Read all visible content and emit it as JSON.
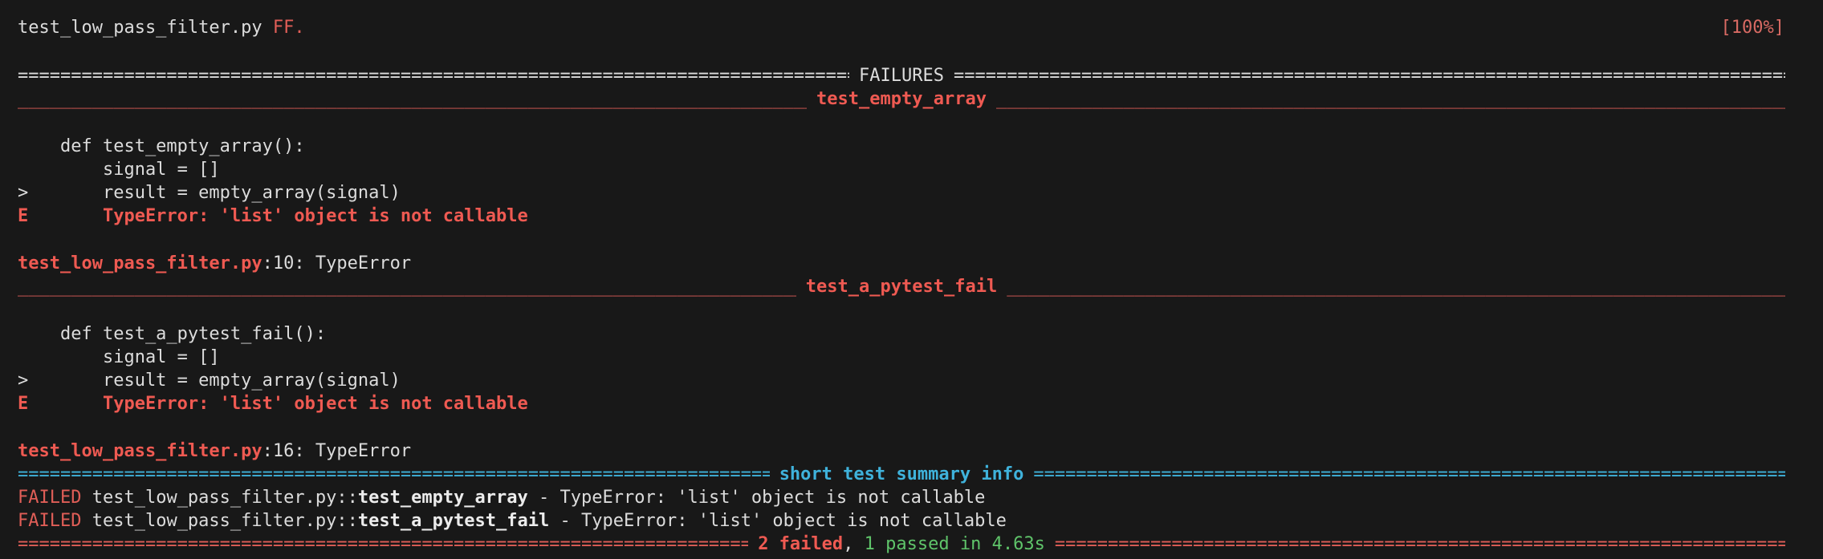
{
  "header": {
    "file": "test_low_pass_filter.py",
    "markers": "FF.",
    "progress": "[100%]"
  },
  "failures_title": "FAILURES",
  "sections": [
    {
      "name": "test_empty_array",
      "code": [
        {
          "prefix": "",
          "text": "    def test_empty_array():"
        },
        {
          "prefix": "",
          "text": "        signal = []"
        },
        {
          "prefix": ">",
          "text": "        result = empty_array(signal)"
        }
      ],
      "error_prefix": "E",
      "error": "        TypeError: 'list' object is not callable",
      "location_file": "test_low_pass_filter.py",
      "location_rest": ":10: TypeError"
    },
    {
      "name": "test_a_pytest_fail",
      "code": [
        {
          "prefix": "",
          "text": "    def test_a_pytest_fail():"
        },
        {
          "prefix": "",
          "text": "        signal = []"
        },
        {
          "prefix": ">",
          "text": "        result = empty_array(signal)"
        }
      ],
      "error_prefix": "E",
      "error": "        TypeError: 'list' object is not callable",
      "location_file": "test_low_pass_filter.py",
      "location_rest": ":16: TypeError"
    }
  ],
  "summary_title": "short test summary info",
  "summary": [
    {
      "status": "FAILED",
      "path": " test_low_pass_filter.py::",
      "test": "test_empty_array",
      "msg": " - TypeError: 'list' object is not callable"
    },
    {
      "status": "FAILED",
      "path": " test_low_pass_filter.py::",
      "test": "test_a_pytest_fail",
      "msg": " - TypeError: 'list' object is not callable"
    }
  ],
  "result": {
    "failed": "2 failed",
    "comma": ",",
    "passed": " 1 passed in 4.63s"
  },
  "colors": {
    "background": "#181818",
    "text": "#dcdcdc",
    "red": "#e05e57",
    "green": "#5fc46a",
    "cyan": "#3fb2db"
  }
}
